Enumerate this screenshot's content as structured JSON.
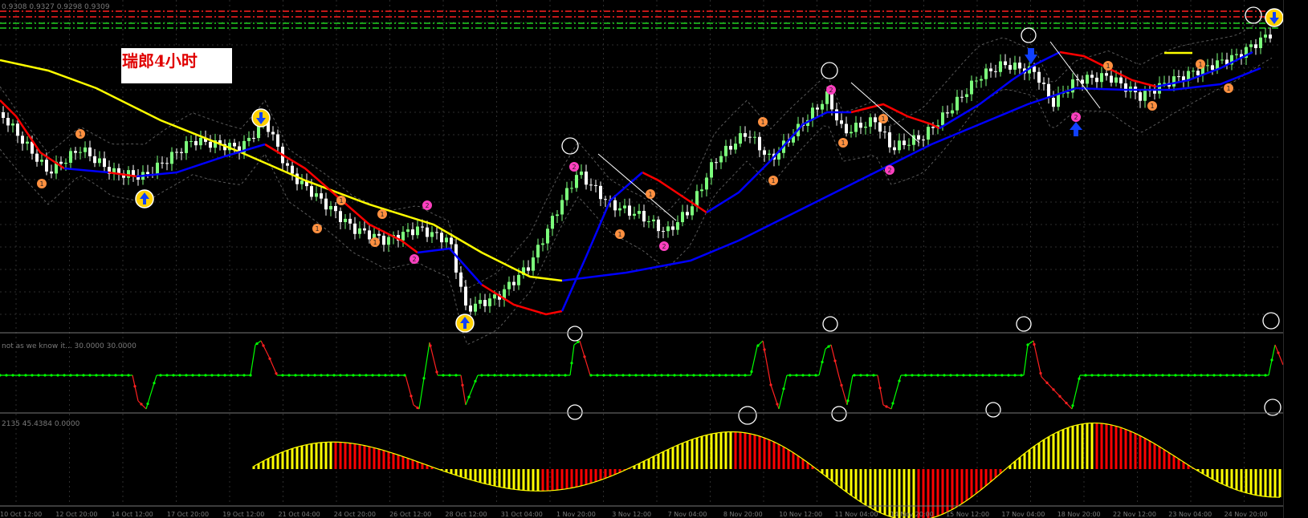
{
  "title": "瑞郎4小时",
  "main_pane": {
    "ohlc_label": "0.9308 0.9327 0.9298 0.9309"
  },
  "sub_pane_1": {
    "label": "not as we know it... 30.0000 30.0000"
  },
  "sub_pane_2": {
    "label": "2135 45.4384 0.0000"
  },
  "time_axis": [
    "10 Oct 12:00",
    "12 Oct 20:00",
    "14 Oct 12:00",
    "17 Oct 20:00",
    "19 Oct 12:00",
    "21 Oct 04:00",
    "24 Oct 20:00",
    "26 Oct 12:00",
    "28 Oct 12:00",
    "31 Oct 04:00",
    "1 Nov 20:00",
    "3 Nov 12:00",
    "7 Nov 04:00",
    "8 Nov 20:00",
    "10 Nov 12:00",
    "11 Nov 04:00",
    "14 Nov 20:00",
    "15 Nov 12:00",
    "17 Nov 04:00",
    "18 Nov 20:00",
    "22 Nov 12:00",
    "23 Nov 04:00",
    "24 Nov 20:00"
  ],
  "colors": {
    "background": "#000000",
    "grid": "#2e2e2e",
    "bull_candle": "#7cff7c",
    "bear_candle": "#ffffff",
    "ma_yellow": "#ffff00",
    "ma_red": "#ff0000",
    "ma_blue": "#0000ff",
    "envelope": "#5a5a5a",
    "resistance_red": "#ff2020",
    "support_green": "#20d020",
    "osc_green": "#00ff00",
    "osc_red": "#ff2020",
    "hist_yellow": "#ffff00",
    "hist_red": "#ff0000"
  },
  "markers": {
    "pink_label": "2",
    "orange_label": "1"
  }
}
